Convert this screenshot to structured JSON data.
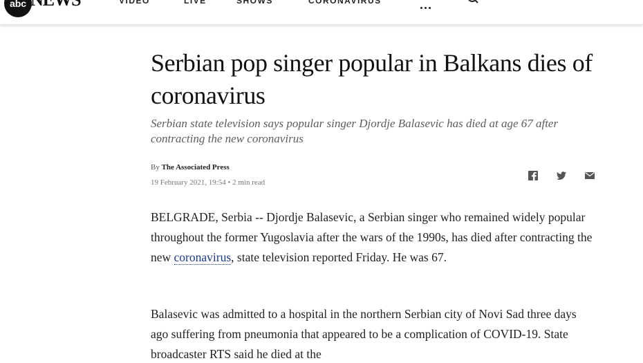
{
  "nav": {
    "logo_mark": "abc",
    "logo_text": "NEWS",
    "items": [
      {
        "label": "VIDEO"
      },
      {
        "label": "LIVE"
      },
      {
        "label": "SHOWS"
      },
      {
        "label": "CORONAVIRUS"
      }
    ],
    "more_icon": "ellipsis-icon",
    "search_icon": "search-icon"
  },
  "article": {
    "headline": "Serbian pop singer popular in Balkans dies of coronavirus",
    "subhead": "Serbian state television says popular singer Djordje Balasevic has died at age 67 after contracting the new coronavirus",
    "byline_prefix": "By",
    "author": "The Associated Press",
    "date": "19 February 2021, 19:54",
    "read_time": "• 2 min read",
    "share": [
      "facebook-icon",
      "twitter-icon",
      "email-icon"
    ],
    "p1_before": "BELGRADE, Serbia -- Djordje Balasevic, a Serbian singer who remained widely popular throughout the former Yugoslavia after the wars of the 1990s, has died after contracting the new ",
    "p1_link": "coronavirus",
    "p1_after": ", state television reported Friday. He was 67.",
    "p2": "Balasevic was admitted to a hospital in the northern Serbian city of Novi Sad three days ago suffering from pneumonia that appeared to be a complication of COVID-19. State broadcaster RTS said he died at the"
  },
  "colors": {
    "link": "#1b3a8a",
    "subhead": "#5d5d5d",
    "text": "#222222"
  }
}
